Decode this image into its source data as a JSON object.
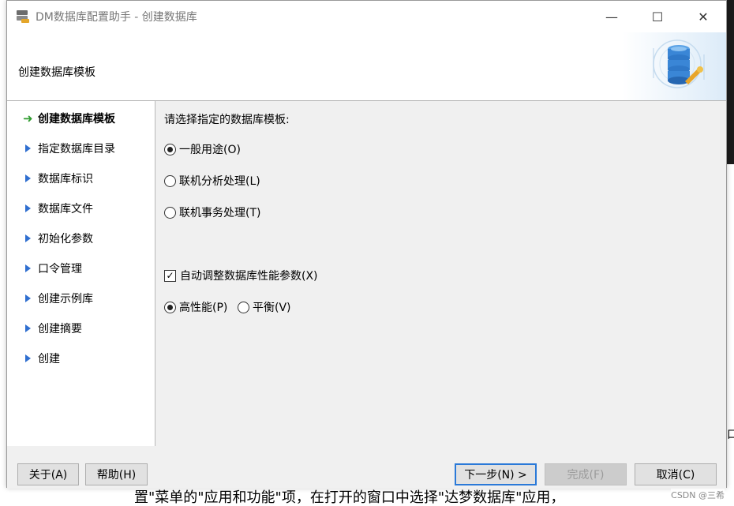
{
  "background": {
    "partial_text": "置\"菜单的\"应用和功能\"项，在打开的窗口中选择\"达梦数据库\"应用，",
    "right_char": "口",
    "watermark": "CSDN @三希"
  },
  "window": {
    "title": "DM数据库配置助手 - 创建数据库",
    "controls": {
      "minimize": "—",
      "maximize": "☐",
      "close": "✕"
    }
  },
  "header": {
    "title": "创建数据库模板"
  },
  "sidebar": {
    "items": [
      {
        "label": "创建数据库模板",
        "active": true
      },
      {
        "label": "指定数据库目录",
        "active": false
      },
      {
        "label": "数据库标识",
        "active": false
      },
      {
        "label": "数据库文件",
        "active": false
      },
      {
        "label": "初始化参数",
        "active": false
      },
      {
        "label": "口令管理",
        "active": false
      },
      {
        "label": "创建示例库",
        "active": false
      },
      {
        "label": "创建摘要",
        "active": false
      },
      {
        "label": "创建",
        "active": false
      }
    ]
  },
  "main": {
    "prompt": "请选择指定的数据库模板:",
    "templates": [
      {
        "label": "一般用途(O)",
        "selected": true
      },
      {
        "label": "联机分析处理(L)",
        "selected": false
      },
      {
        "label": "联机事务处理(T)",
        "selected": false
      }
    ],
    "auto_tune": {
      "label": "自动调整数据库性能参数(X)",
      "checked": true
    },
    "performance": [
      {
        "label": "高性能(P)",
        "selected": true
      },
      {
        "label": "平衡(V)",
        "selected": false
      }
    ]
  },
  "footer": {
    "about": "关于(A)",
    "help": "帮助(H)",
    "next": "下一步(N) >",
    "finish": "完成(F)",
    "cancel": "取消(C)"
  },
  "colors": {
    "accent": "#2a79d8",
    "nav_triangle": "#2f6fd0",
    "active_arrow": "#2f9b2f",
    "db_icon": "#3a86d6"
  }
}
